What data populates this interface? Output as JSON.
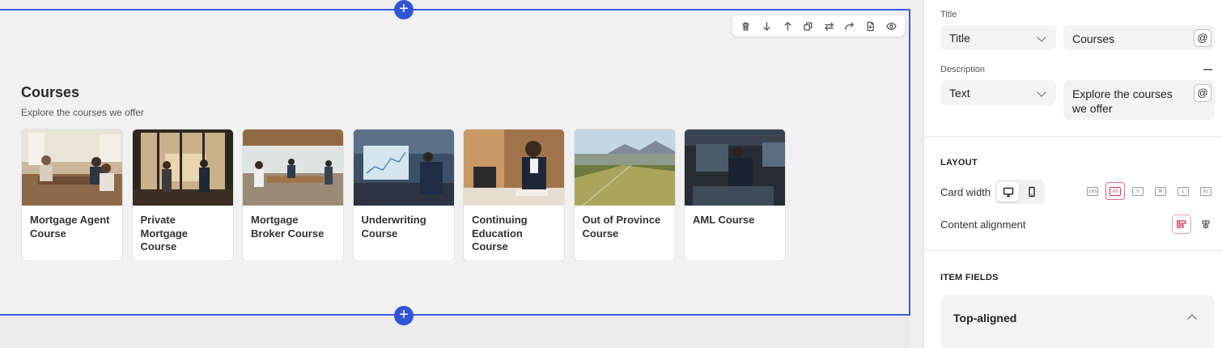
{
  "canvas": {
    "add_label": "+",
    "section": {
      "title": "Courses",
      "description": "Explore the courses we offer",
      "cards": [
        {
          "title": "Mortgage Agent Course"
        },
        {
          "title": "Private Mortgage Course"
        },
        {
          "title": "Mortgage Broker Course"
        },
        {
          "title": "Underwriting Course"
        },
        {
          "title": "Continuing Education Course"
        },
        {
          "title": "Out of Province Course"
        },
        {
          "title": "AML Course"
        }
      ]
    },
    "toolbar": [
      "trash-icon",
      "arrow-down-icon",
      "arrow-up-icon",
      "duplicate-icon",
      "swap-icon",
      "redo-icon",
      "file-icon",
      "eye-icon"
    ]
  },
  "panel": {
    "title_label": "Title",
    "title_type": "Title",
    "title_value": "Courses",
    "description_label": "Description",
    "description_type": "Text",
    "description_value": "Explore the courses we offer",
    "at_symbol": "@",
    "layout_heading": "LAYOUT",
    "card_width_label": "Card width",
    "size_options": [
      "2XS",
      "XS",
      "S",
      "M",
      "L",
      "XL"
    ],
    "selected_size": "XS",
    "content_alignment_label": "Content alignment",
    "item_fields_heading": "ITEM FIELDS",
    "accordion_title": "Top-aligned"
  },
  "colors": {
    "accent": "#2f55d4",
    "selection_border": "#3b5bdb",
    "active_option": "#d1345b"
  }
}
